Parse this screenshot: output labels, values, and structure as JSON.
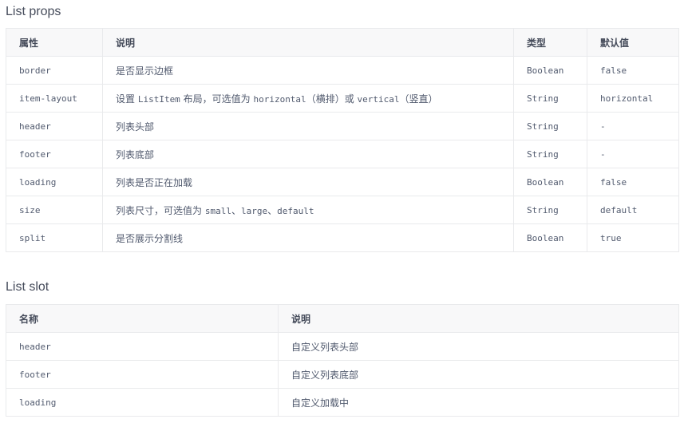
{
  "props": {
    "title": "List props",
    "headers": [
      "属性",
      "说明",
      "类型",
      "默认值"
    ],
    "rows": [
      {
        "name": "border",
        "desc": "是否显示边框",
        "type": "Boolean",
        "default": "false"
      },
      {
        "name": "item-layout",
        "desc_parts": [
          "设置 ",
          "ListItem",
          " 布局，可选值为 ",
          "horizontal",
          "（横排）或 ",
          "vertical",
          "（竖直）"
        ],
        "type": "String",
        "default": "horizontal"
      },
      {
        "name": "header",
        "desc": "列表头部",
        "type": "String",
        "default": "-"
      },
      {
        "name": "footer",
        "desc": "列表底部",
        "type": "String",
        "default": "-"
      },
      {
        "name": "loading",
        "desc": "列表是否正在加载",
        "type": "Boolean",
        "default": "false"
      },
      {
        "name": "size",
        "desc_parts": [
          "列表尺寸，可选值为 ",
          "small",
          "、",
          "large",
          "、",
          "default"
        ],
        "type": "String",
        "default": "default"
      },
      {
        "name": "split",
        "desc": "是否展示分割线",
        "type": "Boolean",
        "default": "true"
      }
    ]
  },
  "slot": {
    "title": "List slot",
    "headers": [
      "名称",
      "说明"
    ],
    "rows": [
      {
        "name": "header",
        "desc": "自定义列表头部"
      },
      {
        "name": "footer",
        "desc": "自定义列表底部"
      },
      {
        "name": "loading",
        "desc": "自定义加载中"
      }
    ]
  }
}
